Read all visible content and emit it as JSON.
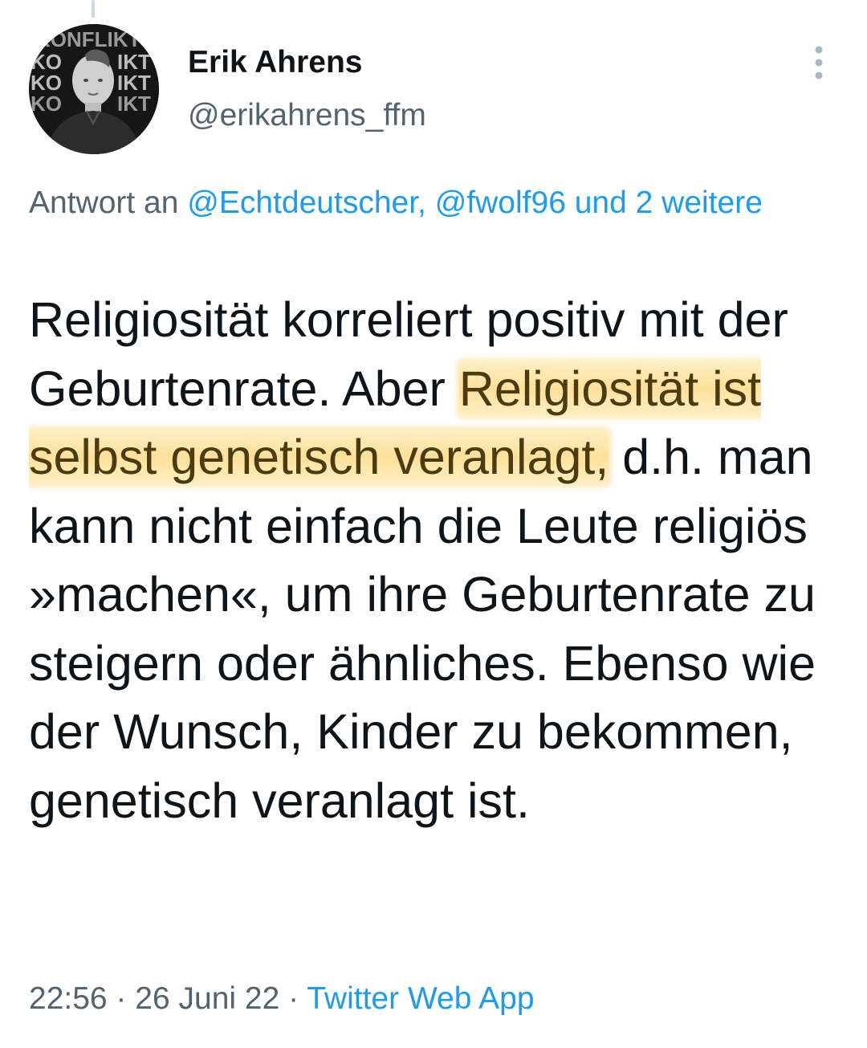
{
  "tweet": {
    "author": {
      "name": "Erik Ahrens",
      "handle": "@erikahrens_ffm",
      "avatar_text": "KONFLIKT"
    },
    "reply": {
      "prefix": "Antwort an ",
      "mention_1": "@Echtdeutscher,",
      "mention_2": "@fwolf96",
      "more": "und 2 weitere"
    },
    "text": {
      "part1": "Religiosität korreliert positiv mit der Geburtenrate. Aber ",
      "highlight": "Religiosität ist selbst genetisch veranlagt,",
      "part2": " d.h. man kann nicht einfach die Leute religiös »machen«, um ihre Geburtenrate zu steigern oder ähnliches. Ebenso wie der Wunsch, Kinder zu bekommen, genetisch veranlagt ist."
    },
    "meta": {
      "time": "22:56",
      "separator": "·",
      "date": "26 Juni 22",
      "source": "Twitter Web App"
    }
  },
  "colors": {
    "primary_text": "#0f1419",
    "secondary_text": "#536471",
    "link": "#1d9bf0",
    "highlight": "#ffd678"
  },
  "icons": {
    "more": "three-dots-vertical-icon"
  }
}
